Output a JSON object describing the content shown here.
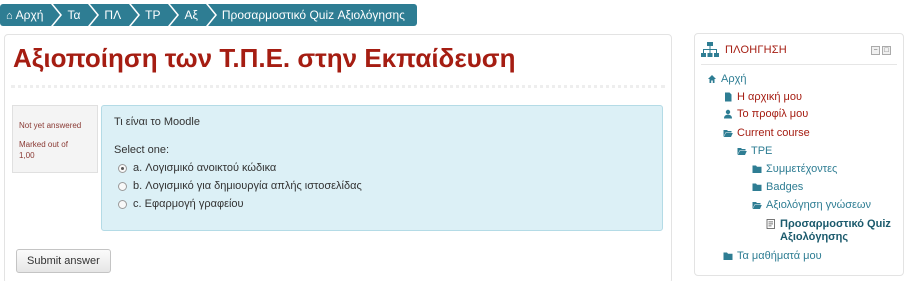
{
  "breadcrumb": [
    {
      "label": "Αρχή",
      "home": true
    },
    {
      "label": "Τα"
    },
    {
      "label": "ΠΛ"
    },
    {
      "label": "ΤΡ"
    },
    {
      "label": "Αξ"
    },
    {
      "label": "Προσαρμοστικό Quiz Αξιολόγησης"
    }
  ],
  "page": {
    "title": "Αξιοποίηση των Τ.Π.Ε. στην Εκπαίδευση"
  },
  "question": {
    "state": "Not yet answered",
    "marked_out_of": "Marked out of",
    "grade": "1,00",
    "text": "Τι είναι το Moodle",
    "prompt": "Select one:",
    "answers": [
      {
        "label": "a. Λογισμικό ανοικτού κώδικα",
        "checked": true
      },
      {
        "label": "b. Λογισμικό για δημιουργία απλής ιστοσελίδας",
        "checked": false
      },
      {
        "label": "c. Εφαρμογή γραφείου",
        "checked": false
      }
    ],
    "submit_label": "Submit answer"
  },
  "navigation": {
    "title": "ΠΛΟΗΓΗΣΗ",
    "items": [
      {
        "label": "Αρχή",
        "icon": "home-icon",
        "color": "blue"
      },
      {
        "label": "Η αρχική μου",
        "icon": "page-icon",
        "color": "red"
      },
      {
        "label": "Το προφίλ μου",
        "icon": "user-icon",
        "color": "red"
      },
      {
        "label": "Current course",
        "icon": "folder-open-icon",
        "color": "red"
      },
      {
        "label": "TPE",
        "icon": "folder-open-icon",
        "color": "blue"
      },
      {
        "label": "Συμμετέχοντες",
        "icon": "folder-icon",
        "color": "blue"
      },
      {
        "label": "Badges",
        "icon": "folder-icon",
        "color": "blue"
      },
      {
        "label": "Αξιολόγηση γνώσεων",
        "icon": "folder-open-icon",
        "color": "blue"
      },
      {
        "label": "Προσαρμοστικό Quiz Αξιολόγησης",
        "icon": "quiz-icon",
        "color": "active"
      },
      {
        "label": "Τα μαθήματά μου",
        "icon": "folder-icon",
        "color": "blue"
      }
    ]
  },
  "colors": {
    "accent": "#2e7d93",
    "title": "#a51d12",
    "question_bg": "#dcf0f6"
  }
}
